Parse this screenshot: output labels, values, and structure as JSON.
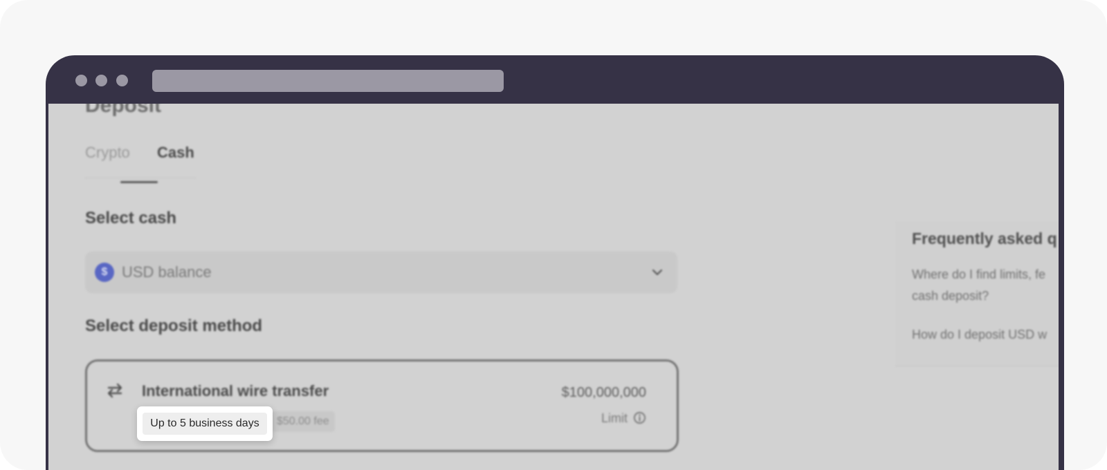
{
  "window": {
    "address_bar": ""
  },
  "page": {
    "title": "Deposit"
  },
  "tabs": [
    {
      "label": "Crypto",
      "active": false
    },
    {
      "label": "Cash",
      "active": true
    }
  ],
  "select_cash": {
    "label": "Select cash",
    "selected": "USD balance",
    "coin_glyph": "$",
    "coin_color": "#5967c4"
  },
  "deposit_method": {
    "label": "Select deposit method",
    "method": {
      "title": "International wire transfer",
      "amount": "$100,000,000",
      "limit_label": "Limit",
      "fee": "$50.00 fee",
      "icon": "swap-arrows-icon"
    }
  },
  "faq": {
    "title": "Frequently asked q",
    "questions": [
      {
        "line1": "Where do I find limits, fe",
        "line2": "cash deposit?"
      },
      {
        "line1": "How do I deposit USD w",
        "line2": ""
      }
    ]
  },
  "tooltip": {
    "text": "Up to 5 business days"
  }
}
